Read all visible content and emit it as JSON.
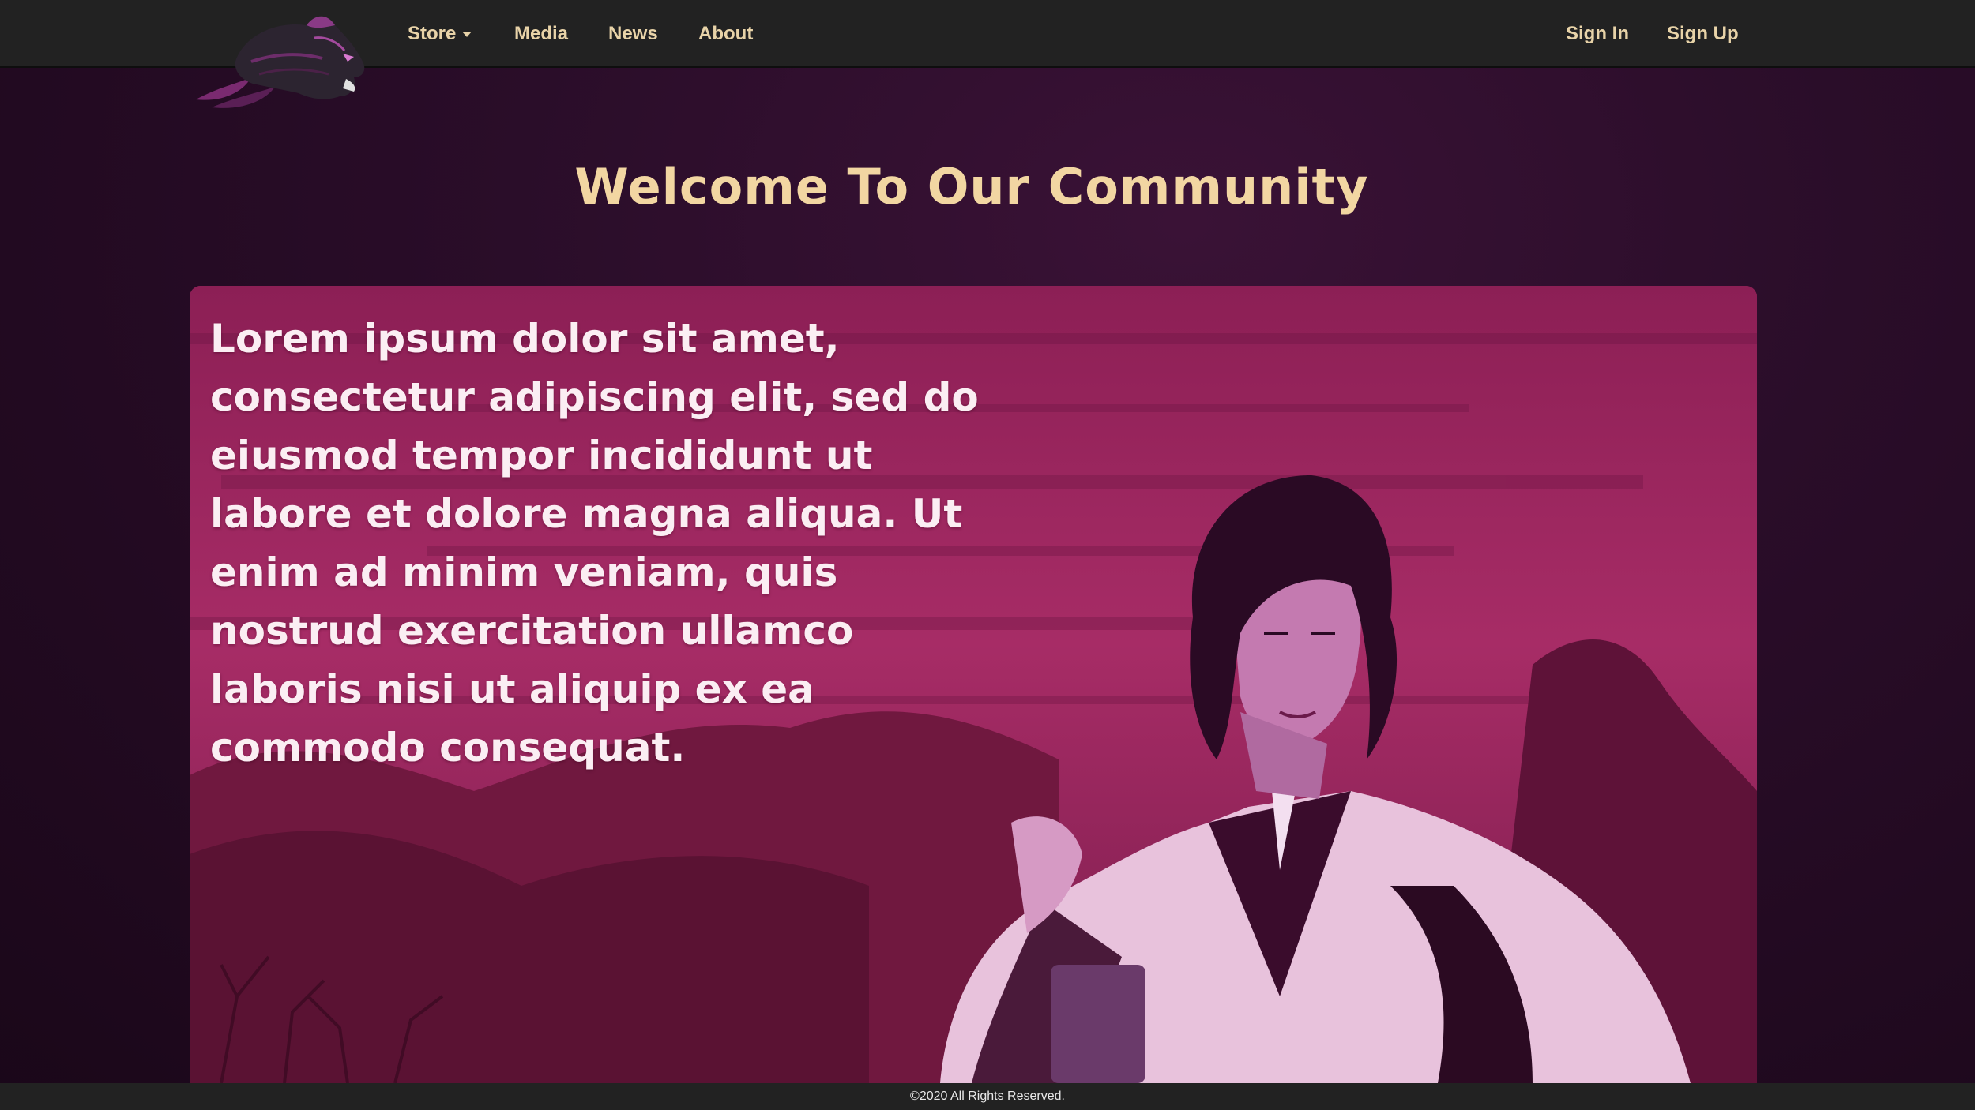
{
  "nav": {
    "logo_icon": "panther-head-icon",
    "items": [
      {
        "label": "Store",
        "has_dropdown": true
      },
      {
        "label": "Media"
      },
      {
        "label": "News"
      },
      {
        "label": "About"
      }
    ],
    "auth": {
      "sign_in": "Sign In",
      "sign_up": "Sign Up"
    }
  },
  "main": {
    "title": "Welcome To Our Community",
    "hero": {
      "text": "Lorem ipsum dolor sit amet, consectetur adipiscing elit, sed do eiusmod tempor incididunt ut labore et dolore magna aliqua. Ut enim ad minim veniam, quis nostrud exercitation ullamco laboris nisi ut aliquip ex ea commodo consequat.",
      "image_icon": "adventurer-woman-illustration"
    }
  },
  "footer": {
    "copyright": "©2020 All Rights Reserved."
  },
  "colors": {
    "navbar": "#222222",
    "nav_text": "#e8d3a8",
    "heading": "#f2d6a2",
    "background": "#2a0d29",
    "hero": "#9f2660"
  }
}
